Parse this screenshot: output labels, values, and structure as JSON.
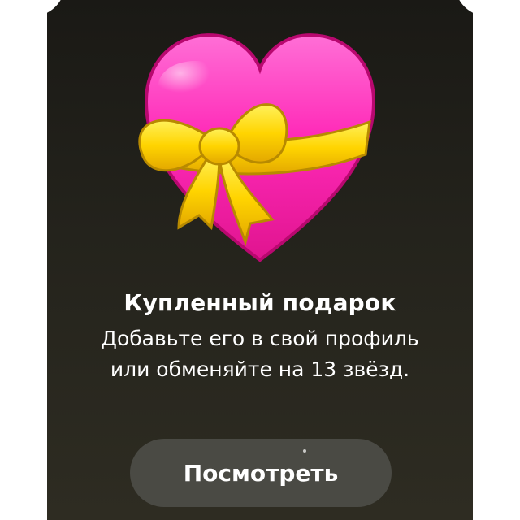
{
  "gift": {
    "icon": "heart-with-ribbon",
    "title": "Купленный подарок",
    "description": "Добавьте его в свой профиль или обменяйте на 13 звёзд.",
    "action_label": "Посмотреть"
  },
  "colors": {
    "card_background": "#24231c",
    "heart_pink": "#ff2db8",
    "ribbon_yellow": "#ffd700",
    "button_background": "#4a4a44",
    "text": "#ffffff"
  }
}
